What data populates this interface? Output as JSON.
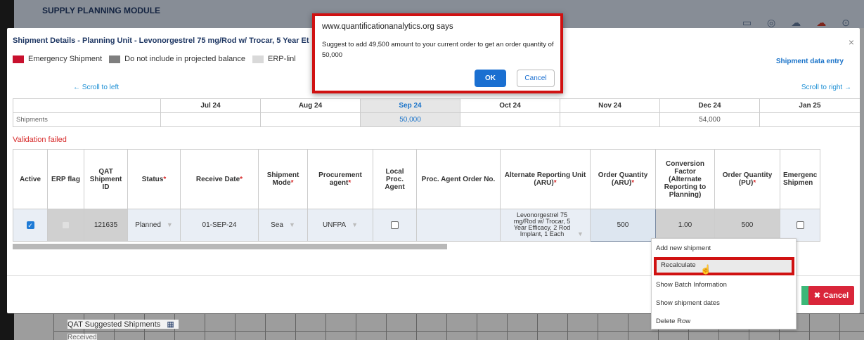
{
  "background": {
    "module_title": "SUPPLY PLANNING MODULE",
    "suggested_label": "QAT Suggested Shipments",
    "received_label": "Received"
  },
  "modal": {
    "title": "Shipment Details - Planning Unit - Levonorgestrel 75 mg/Rod w/ Trocar, 5 Year Et",
    "close_symbol": "×",
    "legend": [
      {
        "label": "Emergency Shipment",
        "color": "#c8102e"
      },
      {
        "label": "Do not include in projected balance",
        "color": "#7f7f7f"
      },
      {
        "label": "ERP-linl",
        "color": "#d9d9d9"
      }
    ],
    "data_entry_link": "Shipment data entry",
    "scroll_left": "← Scroll to left",
    "scroll_right": "Scroll to right →",
    "summary": {
      "months": [
        "Jul 24",
        "Aug 24",
        "Sep 24",
        "Oct 24",
        "Nov 24",
        "Dec 24",
        "Jan 25"
      ],
      "row_label": "Shipments",
      "values": [
        "",
        "",
        "50,000",
        "",
        "",
        "54,000",
        ""
      ]
    },
    "validation": "Validation failed",
    "columns": {
      "active": "Active",
      "erp_flag": "ERP flag",
      "qat_id": "QAT Shipment ID",
      "status": "Status",
      "receive_date": "Receive Date",
      "shipment_mode": "Shipment Mode",
      "procurement_agent": "Procurement agent",
      "local_proc": "Local Proc. Agent",
      "proc_order_no": "Proc. Agent Order No.",
      "aru": "Alternate Reporting Unit (ARU)",
      "order_qty_aru": "Order Quantity (ARU)",
      "conversion": "Conversion Factor (Alternate Reporting to Planning)",
      "order_qty_pu": "Order Quantity (PU)",
      "emergency": "Emergenc Shipmen"
    },
    "row": {
      "qat_id": "121635",
      "status": "Planned",
      "receive_date": "01-SEP-24",
      "shipment_mode": "Sea",
      "procurement_agent": "UNFPA",
      "aru": "Levonorgestrel 75 mg/Rod w/ Trocar, 5 Year Efficacy, 2 Rod Implant, 1 Each",
      "order_qty_aru": "500",
      "conversion": "1.00",
      "order_qty_pu": "500"
    },
    "cancel_button": "Cancel"
  },
  "context_menu": {
    "items": [
      "Add new shipment",
      "Recalculate",
      "Show Batch Information",
      "Show shipment dates",
      "Delete Row"
    ]
  },
  "alert": {
    "title": "www.quantificationanalytics.org says",
    "message": "Suggest to add 49,500 amount to your current order to get an order quantity of 50,000",
    "ok": "OK",
    "cancel": "Cancel"
  }
}
